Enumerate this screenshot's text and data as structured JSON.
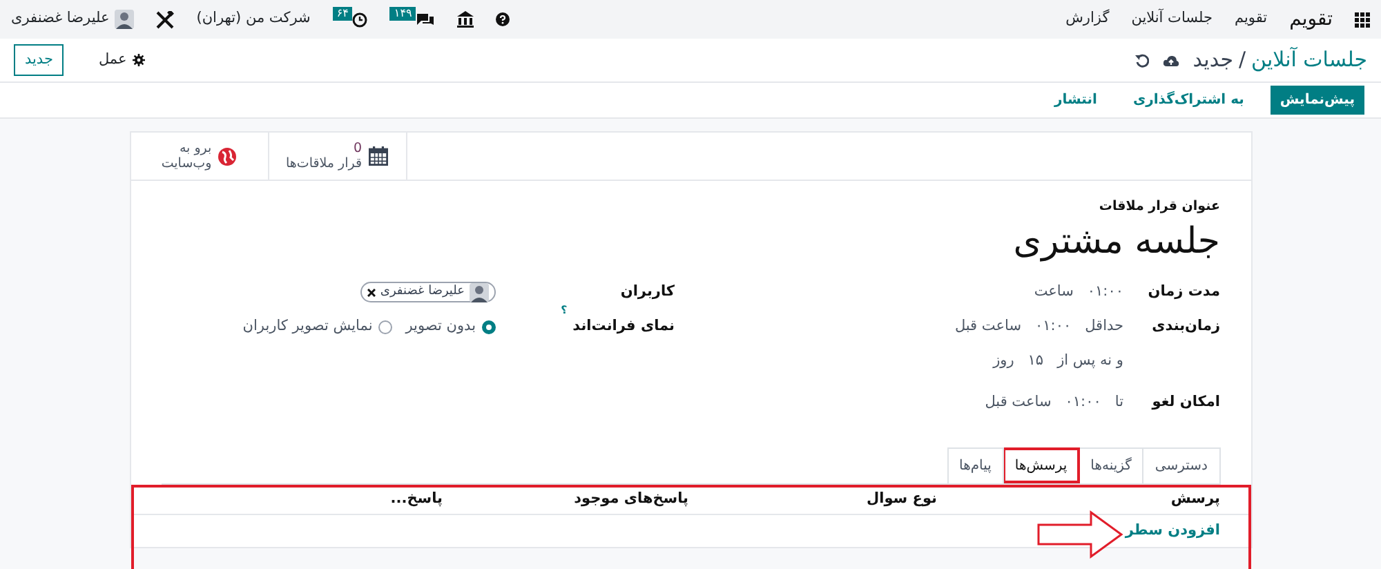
{
  "navbar": {
    "app": "تقویم",
    "menus": [
      "تقویم",
      "جلسات آنلاین",
      "گزارش"
    ],
    "messages_badge": "۱۴۹",
    "activities_badge": "۶۴",
    "company": "شرکت من (تهران)",
    "user": "علیرضا غضنفری"
  },
  "breadcrumb": {
    "parent": "جلسات آنلاین",
    "separator": "/",
    "current": "جدید"
  },
  "actions": {
    "action": "عمل",
    "new": "جدید"
  },
  "status_buttons": [
    {
      "label": "پیش‌نمایش",
      "primary": true
    },
    {
      "label": "به اشتراک‌گذاری",
      "primary": false
    },
    {
      "label": "انتشار",
      "primary": false
    }
  ],
  "smart_buttons": [
    {
      "kind": "meetings",
      "value": "0",
      "lines": [
        "قرار ملاقات‌ها"
      ]
    },
    {
      "kind": "website",
      "lines": [
        "برو به",
        "وب‌سایت"
      ]
    }
  ],
  "form": {
    "title_label": "عنوان قرار ملاقات",
    "title": "جلسه مشتری",
    "duration": {
      "label": "مدت زمان",
      "value": "۰۱:۰۰",
      "unit": "ساعت"
    },
    "scheduling": {
      "label": "زمان‌بندی",
      "min_prefix": "حداقل",
      "min_value": "۰۱:۰۰",
      "min_unit": "ساعت قبل",
      "max_prefix": "و نه پس از",
      "max_value": "۱۵",
      "max_unit": "روز"
    },
    "cancel": {
      "label": "امکان لغو",
      "prefix": "تا",
      "value": "۰۱:۰۰",
      "unit": "ساعت قبل"
    },
    "users": {
      "label": "کاربران",
      "tags": [
        "علیرضا غضنفری"
      ]
    },
    "frontend": {
      "label": "نمای فرانت‌اند",
      "help": "؟",
      "options": [
        {
          "label": "بدون تصویر",
          "selected": true
        },
        {
          "label": "نمایش تصویر کاربران",
          "selected": false
        }
      ]
    }
  },
  "tabs": [
    {
      "label": "دسترسی",
      "selected": false,
      "highlighted": false
    },
    {
      "label": "گزینه‌ها",
      "selected": false,
      "highlighted": false
    },
    {
      "label": "پرسش‌ها",
      "selected": true,
      "highlighted": true
    },
    {
      "label": "پیام‌ها",
      "selected": false,
      "highlighted": false
    }
  ],
  "table": {
    "columns": [
      "پرسش",
      "نوع سوال",
      "پاسخ‌های موجود",
      "پاسخ..."
    ],
    "add_line": "افزودن سطر",
    "highlighted": true,
    "annotation_arrow": true
  }
}
